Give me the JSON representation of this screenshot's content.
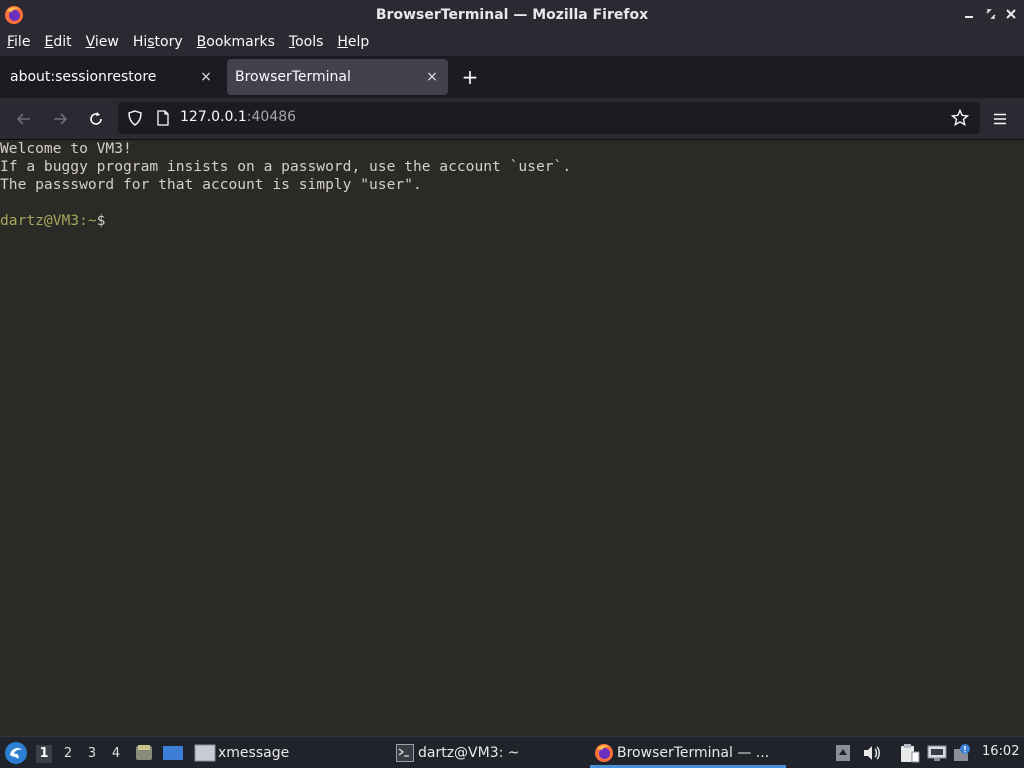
{
  "window": {
    "title": "BrowserTerminal — Mozilla Firefox",
    "minimize_glyph": "▴",
    "maximize_glyph": "◈",
    "close_glyph": "✕"
  },
  "menu": {
    "items": [
      {
        "u": "F",
        "rest": "ile"
      },
      {
        "u": "E",
        "rest": "dit"
      },
      {
        "u": "V",
        "rest": "iew"
      },
      {
        "pre": "Hi",
        "u": "s",
        "rest": "tory"
      },
      {
        "u": "B",
        "rest": "ookmarks"
      },
      {
        "u": "T",
        "rest": "ools"
      },
      {
        "u": "H",
        "rest": "elp"
      }
    ]
  },
  "tabs": [
    {
      "label": "about:sessionrestore",
      "close": "×"
    },
    {
      "label": "BrowserTerminal",
      "close": "×"
    }
  ],
  "new_tab_glyph": "+",
  "url": {
    "host": "127.0.0.1",
    "port": ":40486"
  },
  "terminal": {
    "lines": [
      "Welcome to VM3!",
      "If a buggy program insists on a password, use the account `user`.",
      "The passsword for that account is simply \"user\".",
      ""
    ],
    "prompt": "dartz@VM3:~",
    "prompt_suffix": "$"
  },
  "taskbar": {
    "workspaces": [
      "1",
      "2",
      "3",
      "4"
    ],
    "tasks": {
      "xmessage": "xmessage",
      "terminal": "dartz@VM3: ~",
      "firefox": "BrowserTerminal — ..."
    },
    "clock": "16:02"
  },
  "colors": {
    "accent": "#4a90d9",
    "prompt": "#a0a85a",
    "terminal_bg": "#2b2a27"
  }
}
